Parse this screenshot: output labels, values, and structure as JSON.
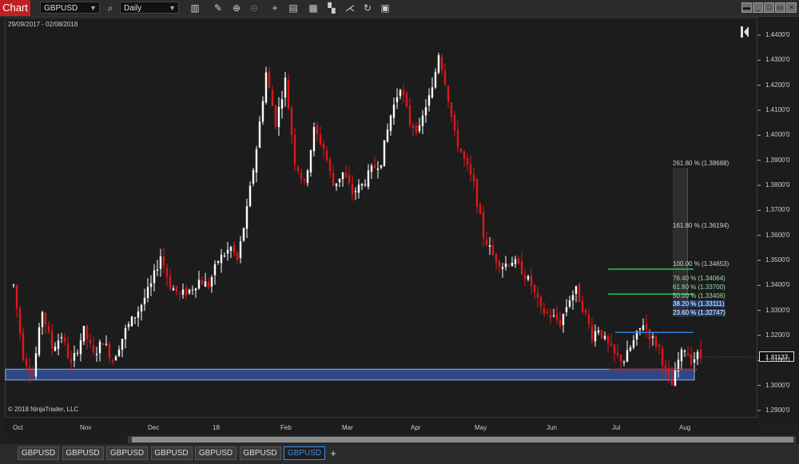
{
  "toolbar": {
    "chart_label": "Chart",
    "instrument": "GBPUSD",
    "interval": "Daily",
    "icons": [
      "bar-style-icon",
      "draw-pencil-icon",
      "zoom-in-icon",
      "zoom-out-icon",
      "crosshair-icon",
      "properties-icon",
      "data-series-icon",
      "indicators-icon",
      "strategies-icon",
      "reload-icon",
      "templates-icon"
    ]
  },
  "chart": {
    "date_range": "29/09/2017 - 02/08/2018",
    "copyright": "© 2018 NinjaTrader, LLC",
    "current_price": "1.31127",
    "colors": {
      "up": "#ffffff",
      "down": "#e0161c",
      "fib_green": "#23c94b",
      "fib_blue": "#2e7de0",
      "zone": "#3557a8"
    }
  },
  "chart_data": {
    "type": "candlestick",
    "y_ticks": [
      "1.4400'0",
      "1.4300'0",
      "1.4200'0",
      "1.4100'0",
      "1.4000'0",
      "1.3900'0",
      "1.3800'0",
      "1.3700'0",
      "1.3600'0",
      "1.3500'0",
      "1.3400'0",
      "1.3300'0",
      "1.3200'0",
      "1.3100'0",
      "1.3000'0",
      "1.2900'0"
    ],
    "x_ticks": [
      "Oct",
      "Nov",
      "Dec",
      "18",
      "Feb",
      "Mar",
      "Apr",
      "May",
      "Jun",
      "Jul",
      "Aug"
    ],
    "ylim": [
      1.2875,
      1.4455
    ],
    "close_path": [
      [
        0,
        1.34
      ],
      [
        6,
        1.312
      ],
      [
        12,
        1.304
      ],
      [
        18,
        1.33
      ],
      [
        24,
        1.315
      ],
      [
        30,
        1.32
      ],
      [
        36,
        1.308
      ],
      [
        44,
        1.322
      ],
      [
        50,
        1.312
      ],
      [
        56,
        1.318
      ],
      [
        62,
        1.31
      ],
      [
        70,
        1.322
      ],
      [
        78,
        1.33
      ],
      [
        86,
        1.34
      ],
      [
        92,
        1.352
      ],
      [
        98,
        1.34
      ],
      [
        104,
        1.336
      ],
      [
        110,
        1.338
      ],
      [
        116,
        1.342
      ],
      [
        122,
        1.34
      ],
      [
        128,
        1.35
      ],
      [
        136,
        1.355
      ],
      [
        140,
        1.35
      ],
      [
        146,
        1.37
      ],
      [
        152,
        1.395
      ],
      [
        158,
        1.425
      ],
      [
        164,
        1.405
      ],
      [
        170,
        1.422
      ],
      [
        176,
        1.39
      ],
      [
        182,
        1.38
      ],
      [
        188,
        1.402
      ],
      [
        194,
        1.395
      ],
      [
        200,
        1.38
      ],
      [
        206,
        1.385
      ],
      [
        212,
        1.377
      ],
      [
        218,
        1.38
      ],
      [
        224,
        1.386
      ],
      [
        230,
        1.39
      ],
      [
        236,
        1.408
      ],
      [
        242,
        1.42
      ],
      [
        248,
        1.405
      ],
      [
        254,
        1.402
      ],
      [
        258,
        1.412
      ],
      [
        262,
        1.418
      ],
      [
        266,
        1.433
      ],
      [
        270,
        1.422
      ],
      [
        276,
        1.4
      ],
      [
        282,
        1.39
      ],
      [
        288,
        1.38
      ],
      [
        294,
        1.36
      ],
      [
        300,
        1.352
      ],
      [
        306,
        1.348
      ],
      [
        312,
        1.35
      ],
      [
        318,
        1.346
      ],
      [
        324,
        1.34
      ],
      [
        330,
        1.33
      ],
      [
        336,
        1.328
      ],
      [
        342,
        1.325
      ],
      [
        348,
        1.335
      ],
      [
        352,
        1.338
      ],
      [
        358,
        1.328
      ],
      [
        362,
        1.32
      ],
      [
        366,
        1.323
      ],
      [
        370,
        1.318
      ],
      [
        376,
        1.312
      ],
      [
        382,
        1.31
      ],
      [
        386,
        1.315
      ],
      [
        390,
        1.32
      ],
      [
        394,
        1.325
      ],
      [
        398,
        1.32
      ],
      [
        404,
        1.315
      ],
      [
        408,
        1.305
      ],
      [
        412,
        1.3
      ],
      [
        416,
        1.31
      ],
      [
        420,
        1.315
      ],
      [
        424,
        1.31
      ],
      [
        428,
        1.312
      ],
      [
        432,
        1.311
      ]
    ],
    "fib_levels": [
      {
        "label": "261.80 % (1.38688)",
        "price": 1.38688
      },
      {
        "label": "161.80 % (1.36194)",
        "price": 1.36194
      },
      {
        "label": "100.00 % (1.34653)",
        "price": 1.34653
      },
      {
        "label": "76.40 % (1.34064)",
        "price": 1.34064
      },
      {
        "label": "61.80 % (1.33700)",
        "price": 1.337
      },
      {
        "label": "50.00 % (1.33406)",
        "price": 1.33406
      },
      {
        "label": "38.20 % (1.33111)",
        "price": 1.33111
      },
      {
        "label": "23.60 % (1.32747)",
        "price": 1.32747
      }
    ],
    "support_zone": [
      1.3022,
      1.3065
    ],
    "horizontal_lines": [
      {
        "color": "green",
        "price": 1.3465
      },
      {
        "color": "green",
        "price": 1.3365
      },
      {
        "color": "blue",
        "price": 1.3212
      },
      {
        "color": "red",
        "price": 1.3064
      }
    ]
  },
  "tabs": {
    "items": [
      "GBPUSD",
      "GBPUSD",
      "GBPUSD",
      "GBPUSD",
      "GBPUSD",
      "GBPUSD",
      "GBPUSD"
    ],
    "active_index": 6,
    "add_label": "+"
  }
}
